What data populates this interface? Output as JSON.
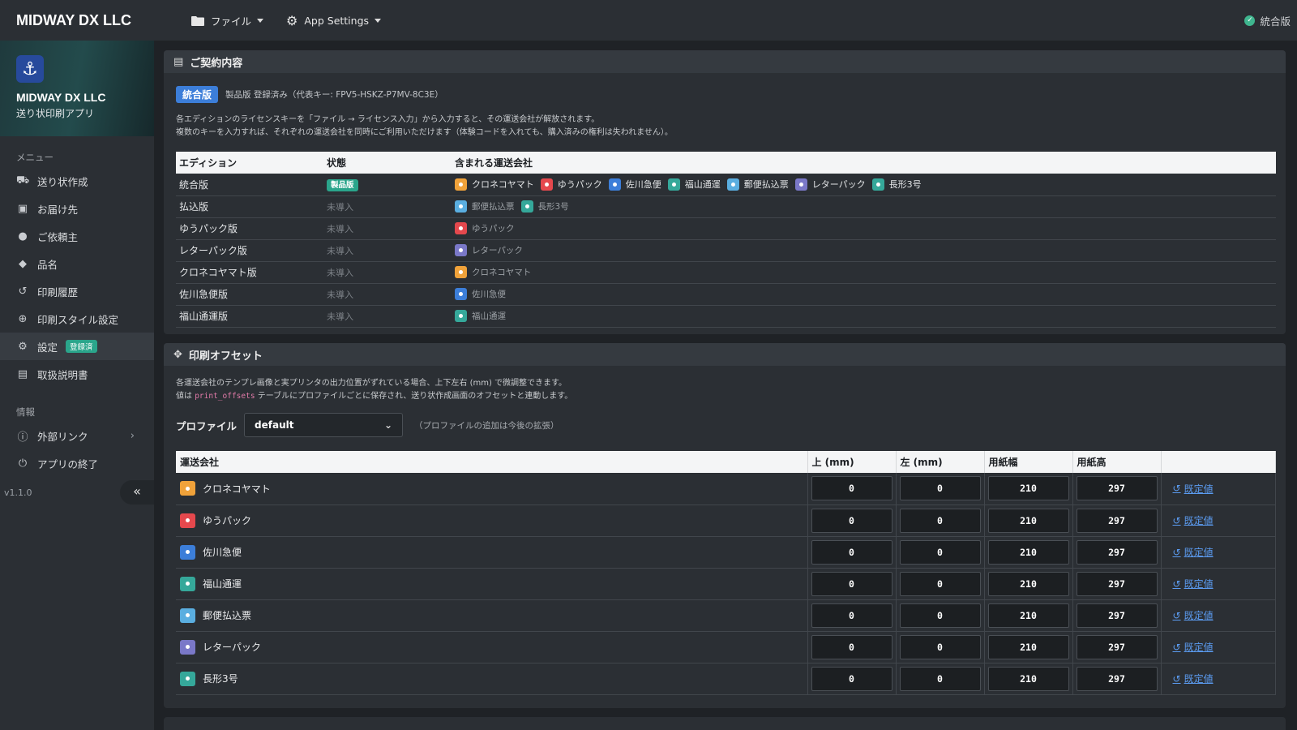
{
  "topbar": {
    "brand": "MIDWAY DX LLC",
    "file_menu": "ファイル",
    "settings_menu": "App Settings",
    "edition_status": "統合版"
  },
  "sidebar": {
    "hero_title": "MIDWAY DX LLC",
    "hero_subtitle": "送り状印刷アプリ",
    "menu_heading": "メニュー",
    "items": [
      {
        "label": "送り状作成",
        "icon": "truck-icon"
      },
      {
        "label": "お届け先",
        "icon": "address-book-icon"
      },
      {
        "label": "ご依頼主",
        "icon": "user-icon"
      },
      {
        "label": "品名",
        "icon": "tags-icon"
      },
      {
        "label": "印刷履歴",
        "icon": "history-icon"
      },
      {
        "label": "印刷スタイル設定",
        "icon": "crosshair-icon"
      },
      {
        "label": "設定",
        "icon": "gear-icon",
        "badge": "登録済",
        "active": true
      },
      {
        "label": "取扱説明書",
        "icon": "book-icon"
      }
    ],
    "info_heading": "情報",
    "info_items": [
      {
        "label": "外部リンク",
        "icon": "info-icon"
      },
      {
        "label": "アプリの終了",
        "icon": "power-icon"
      }
    ],
    "version": "v1.1.0",
    "collapse_label": "«"
  },
  "contract": {
    "title": "ご契約内容",
    "edition_badge": "統合版",
    "registration": "製品版 登録済み（代表キー: FPV5-HSKZ-P7MV-8C3E）",
    "desc_line1": "各エディションのライセンスキーを「ファイル → ライセンス入力」から入力すると、その運送会社が解放されます。",
    "desc_line2": "複数のキーを入力すれば、それぞれの運送会社を同時にご利用いただけます（体験コードを入れても、購入済みの権利は失われません）。",
    "headers": [
      "エディション",
      "状態",
      "含まれる運送会社"
    ],
    "rows": [
      {
        "edition": "統合版",
        "status": "製品版",
        "active": true,
        "carriers": [
          "クロネコヤマト",
          "ゆうパック",
          "佐川急便",
          "福山通運",
          "郵便払込票",
          "レターパック",
          "長形3号"
        ]
      },
      {
        "edition": "払込版",
        "status": "未導入",
        "active": false,
        "carriers": [
          "郵便払込票",
          "長形3号"
        ]
      },
      {
        "edition": "ゆうパック版",
        "status": "未導入",
        "active": false,
        "carriers": [
          "ゆうパック"
        ]
      },
      {
        "edition": "レターパック版",
        "status": "未導入",
        "active": false,
        "carriers": [
          "レターパック"
        ]
      },
      {
        "edition": "クロネコヤマト版",
        "status": "未導入",
        "active": false,
        "carriers": [
          "クロネコヤマト"
        ]
      },
      {
        "edition": "佐川急便版",
        "status": "未導入",
        "active": false,
        "carriers": [
          "佐川急便"
        ]
      },
      {
        "edition": "福山通運版",
        "status": "未導入",
        "active": false,
        "carriers": [
          "福山通運"
        ]
      }
    ]
  },
  "carrier_colors": {
    "クロネコヤマト": "#f0a23a",
    "ゆうパック": "#e5484d",
    "佐川急便": "#3c7ed9",
    "福山通運": "#35a89a",
    "郵便払込票": "#5aaee0",
    "レターパック": "#7a78c8",
    "長形3号": "#35a89a"
  },
  "offsets": {
    "title": "印刷オフセット",
    "desc_line1": "各運送会社のテンプレ画像と実プリンタの出力位置がずれている場合、上下左右 (mm) で微調整できます。",
    "desc_line2_pre": "値は",
    "desc_code": "print_offsets",
    "desc_line2_post": "テーブルにプロファイルごとに保存され、送り状作成画面のオフセットと連動します。",
    "profile_label": "プロファイル",
    "profile_value": "default",
    "profile_note": "（プロファイルの追加は今後の拡張）",
    "headers": [
      "運送会社",
      "上 (mm)",
      "左 (mm)",
      "用紙幅",
      "用紙高",
      ""
    ],
    "reset_label": "既定値",
    "rows": [
      {
        "carrier": "クロネコヤマト",
        "top": "0",
        "left": "0",
        "width": "210",
        "height": "297"
      },
      {
        "carrier": "ゆうパック",
        "top": "0",
        "left": "0",
        "width": "210",
        "height": "297"
      },
      {
        "carrier": "佐川急便",
        "top": "0",
        "left": "0",
        "width": "210",
        "height": "297"
      },
      {
        "carrier": "福山通運",
        "top": "0",
        "left": "0",
        "width": "210",
        "height": "297"
      },
      {
        "carrier": "郵便払込票",
        "top": "0",
        "left": "0",
        "width": "210",
        "height": "297"
      },
      {
        "carrier": "レターパック",
        "top": "0",
        "left": "0",
        "width": "210",
        "height": "297"
      },
      {
        "carrier": "長形3号",
        "top": "0",
        "left": "0",
        "width": "210",
        "height": "297"
      }
    ]
  }
}
